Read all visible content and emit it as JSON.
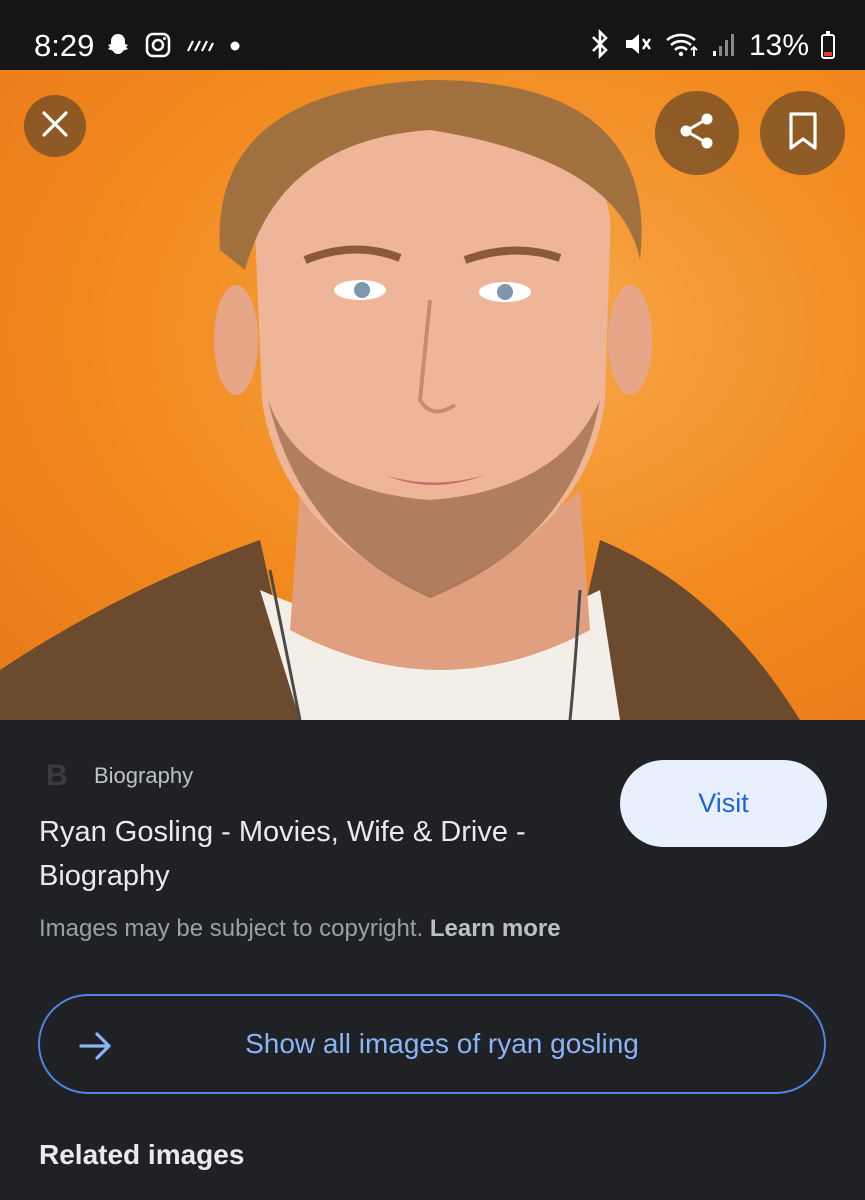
{
  "status_bar": {
    "time": "8:29",
    "left_icons": [
      "snapchat-icon",
      "instagram-icon",
      "signal-lines-icon",
      "dot-icon"
    ],
    "right_icons": [
      "bluetooth-icon",
      "mute-icon",
      "wifi-icon",
      "cellular-signal-icon"
    ],
    "battery_percent": "13%"
  },
  "hero": {
    "actions": [
      "close-icon",
      "share-icon",
      "bookmark-icon"
    ],
    "background_color": "#f28a1e"
  },
  "result": {
    "source_logo": "B",
    "source_name": "Biography",
    "title": "Ryan Gosling - Movies, Wife & Drive - Biography",
    "visit_label": "Visit",
    "copyright_text": "Images may be subject to copyright.",
    "learn_more": "Learn more"
  },
  "show_all": {
    "label": "Show all images of ryan gosling",
    "icon": "arrow-right-icon"
  },
  "related_heading": "Related images",
  "colors": {
    "accent": "#8ab4f8",
    "visit_bg": "#e8f0fe",
    "panel_bg": "#202124"
  }
}
